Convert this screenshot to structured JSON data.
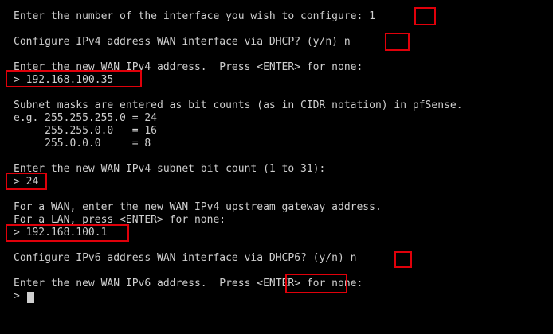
{
  "lines": [
    "Enter the number of the interface you wish to configure: 1",
    "Configure IPv4 address WAN interface via DHCP? (y/n) n",
    "Enter the new WAN IPv4 address.  Press <ENTER> for none:",
    "> 192.168.100.35",
    "Subnet masks are entered as bit counts (as in CIDR notation) in pfSense.",
    "e.g. 255.255.255.0 = 24",
    "     255.255.0.0   = 16",
    "     255.0.0.0     = 8",
    "Enter the new WAN IPv4 subnet bit count (1 to 31):",
    "> 24",
    "For a WAN, enter the new WAN IPv4 upstream gateway address.",
    "For a LAN, press <ENTER> for none:",
    "> 192.168.100.1",
    "Configure IPv6 address WAN interface via DHCP6? (y/n) n",
    "Enter the new WAN IPv6 address.  Press <ENTER> for none:",
    "> "
  ],
  "highlight_color": "#e0000a",
  "text_color": "#cfcfcf",
  "background_color": "#000000"
}
